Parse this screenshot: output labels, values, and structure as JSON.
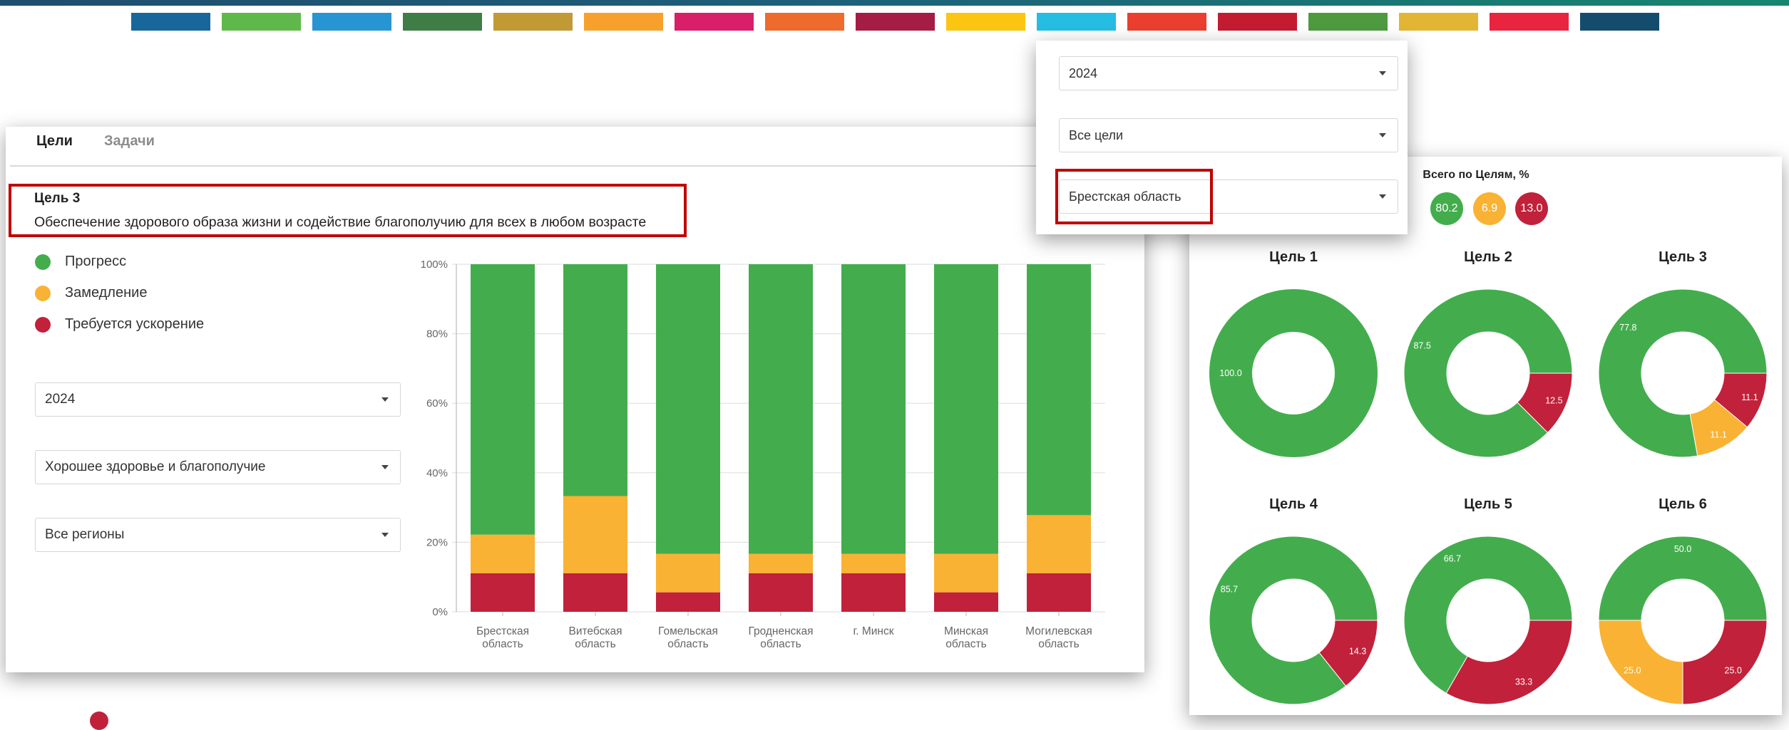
{
  "colors": {
    "progress": "#43ad4d",
    "slowdown": "#f9b233",
    "acceleration": "#c1213a",
    "highlight": "#c00000"
  },
  "sdg_colors": [
    "#18679b",
    "#5fb94a",
    "#2795d2",
    "#3e7d46",
    "#c19a36",
    "#f7a12c",
    "#d81f69",
    "#ee6a2d",
    "#a51c44",
    "#fbc511",
    "#26bde2",
    "#ea3f2e",
    "#c31c31",
    "#4d9a3f",
    "#e3b534",
    "#e9243f",
    "#144c6e"
  ],
  "tabs": {
    "goals": "Цели",
    "tasks": "Задачи"
  },
  "goal": {
    "title": "Цель 3",
    "description": "Обеспечение здорового образа жизни и содействие благополучию для всех в любом возрасте"
  },
  "legend": {
    "progress": "Прогресс",
    "slowdown": "Замедление",
    "acceleration": "Требуется ускорение"
  },
  "left_filters": {
    "year": "2024",
    "goal": "Хорошее здоровье и благополучие",
    "region": "Все регионы"
  },
  "top_filters": {
    "year": "2024",
    "goal": "Все цели",
    "region": "Брестская область"
  },
  "totals": {
    "title": "Всего по Целям, %",
    "progress": "80.2",
    "slowdown": "6.9",
    "acceleration": "13.0"
  },
  "donut_titles": [
    "Цель 1",
    "Цель 2",
    "Цель 3",
    "Цель 4",
    "Цель 5",
    "Цель 6"
  ],
  "chart_data": [
    {
      "type": "bar",
      "stacked": true,
      "percent": true,
      "categories": [
        [
          "Брестская",
          "область"
        ],
        [
          "Витебская",
          "область"
        ],
        [
          "Гомельская",
          "область"
        ],
        [
          "Гродненская",
          "область"
        ],
        [
          "г. Минск"
        ],
        [
          "Минская",
          "область"
        ],
        [
          "Могилевская",
          "область"
        ]
      ],
      "series": [
        {
          "name": "Требуется ускорение",
          "color": "#c1213a",
          "values": [
            11.1,
            11.1,
            5.6,
            11.1,
            11.1,
            5.6,
            11.1
          ]
        },
        {
          "name": "Замедление",
          "color": "#f9b233",
          "values": [
            11.1,
            22.2,
            11.1,
            5.6,
            5.6,
            11.1,
            16.7
          ]
        },
        {
          "name": "Прогресс",
          "color": "#43ad4d",
          "values": [
            77.8,
            66.7,
            83.3,
            83.3,
            83.3,
            83.3,
            72.2
          ]
        }
      ],
      "ylim": [
        0,
        100
      ],
      "yticks": [
        "0%",
        "20%",
        "40%",
        "60%",
        "80%",
        "100%"
      ],
      "grid": true,
      "legend": "left"
    },
    {
      "type": "pie",
      "title": "Цель 1",
      "values": [
        100.0,
        0,
        0
      ],
      "labels": [
        "100.0",
        "",
        ""
      ]
    },
    {
      "type": "pie",
      "title": "Цель 2",
      "values": [
        87.5,
        0,
        12.5
      ],
      "labels": [
        "87.5",
        "",
        "12.5"
      ]
    },
    {
      "type": "pie",
      "title": "Цель 3",
      "values": [
        77.8,
        11.1,
        11.1
      ],
      "labels": [
        "77.8",
        "11.1",
        "11.1"
      ]
    },
    {
      "type": "pie",
      "title": "Цель 4",
      "values": [
        85.7,
        0,
        14.3
      ],
      "labels": [
        "85.7",
        "",
        "14.3"
      ]
    },
    {
      "type": "pie",
      "title": "Цель 5",
      "values": [
        66.7,
        0,
        33.3
      ],
      "labels": [
        "66.7",
        "",
        "33.3"
      ]
    },
    {
      "type": "pie",
      "title": "Цель 6",
      "values": [
        50.0,
        25.0,
        25.0
      ],
      "labels": [
        "50.0",
        "25.0",
        "25.0"
      ]
    }
  ]
}
